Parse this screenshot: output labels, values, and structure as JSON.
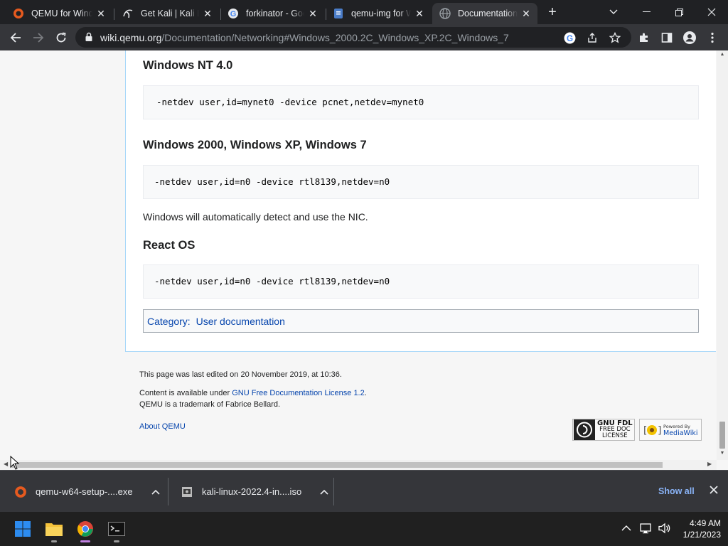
{
  "browser": {
    "tabs": [
      {
        "title": "QEMU for Windows",
        "icon": "qemu-icon",
        "active": false
      },
      {
        "title": "Get Kali | Kali Linux",
        "icon": "kali-icon",
        "active": false
      },
      {
        "title": "forkinator - Google",
        "icon": "google-icon",
        "active": false
      },
      {
        "title": "qemu-img for Windows",
        "icon": "doc-icon",
        "active": false
      },
      {
        "title": "Documentation/Networking",
        "icon": "globe-icon",
        "active": true
      }
    ],
    "new_tab_label": "+",
    "url_host": "wiki.qemu.org",
    "url_path": "/Documentation/Networking#Windows_2000.2C_Windows_XP.2C_Windows_7"
  },
  "page": {
    "sections": [
      {
        "heading": "Windows NT 4.0",
        "code": " -netdev user,id=mynet0 -device pcnet,netdev=mynet0"
      },
      {
        "heading": "Windows 2000, Windows XP, Windows 7",
        "code": "-netdev user,id=n0 -device rtl8139,netdev=n0",
        "note": "Windows will automatically detect and use the NIC."
      },
      {
        "heading": "React OS",
        "code": "-netdev user,id=n0 -device rtl8139,netdev=n0"
      }
    ],
    "category_label": "Category:",
    "category_link": "User documentation",
    "footer": {
      "last_edited": "This page was last edited on 20 November 2019, at 10:36.",
      "content_prefix": "Content is available under ",
      "license_link": "GNU Free Documentation License 1.2",
      "content_suffix": ".",
      "trademark": "QEMU is a trademark of Fabrice Bellard.",
      "about_link": "About QEMU",
      "gnu_badge_line1": "GNU FDL",
      "gnu_badge_line2": "FREE DOC",
      "gnu_badge_line3": "LICENSE",
      "mw_badge_line1": "Powered By",
      "mw_badge_line2": "MediaWiki"
    }
  },
  "downloads": {
    "items": [
      {
        "name": "qemu-w64-setup-....exe",
        "icon": "qemu-icon"
      },
      {
        "name": "kali-linux-2022.4-in....iso",
        "icon": "iso-file-icon"
      }
    ],
    "show_all": "Show all"
  },
  "taskbar": {
    "time": "4:49 AM",
    "date": "1/21/2023"
  },
  "colors": {
    "link": "#0645ad",
    "chrome_dark": "#202124",
    "chrome_toolbar": "#35363a",
    "show_all": "#8ab4f8"
  }
}
